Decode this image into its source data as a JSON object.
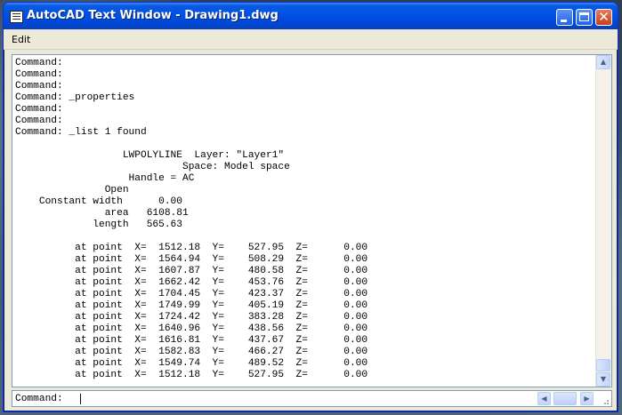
{
  "window": {
    "title": "AutoCAD Text Window - Drawing1.dwg",
    "icons": {
      "app": "text-window-icon",
      "minimize": "minimize-icon",
      "maximize": "maximize-icon",
      "close": "close-icon"
    }
  },
  "menu": {
    "items": [
      "Edit"
    ]
  },
  "log": {
    "lines": [
      "Command:",
      "Command:",
      "Command:",
      "Command: _properties",
      "Command:",
      "Command:",
      "Command: _list 1 found",
      "",
      "                  LWPOLYLINE  Layer: \"Layer1\"",
      "                            Space: Model space",
      "                   Handle = AC",
      "               Open",
      "    Constant width      0.00",
      "               area   6108.81",
      "             length   565.63",
      "",
      "          at point  X=  1512.18  Y=    527.95  Z=      0.00",
      "          at point  X=  1564.94  Y=    508.29  Z=      0.00",
      "          at point  X=  1607.87  Y=    480.58  Z=      0.00",
      "          at point  X=  1662.42  Y=    453.76  Z=      0.00",
      "          at point  X=  1704.45  Y=    423.37  Z=      0.00",
      "          at point  X=  1749.99  Y=    405.19  Z=      0.00",
      "          at point  X=  1724.42  Y=    383.28  Z=      0.00",
      "          at point  X=  1640.96  Y=    438.56  Z=      0.00",
      "          at point  X=  1616.81  Y=    437.67  Z=      0.00",
      "          at point  X=  1582.83  Y=    466.27  Z=      0.00",
      "          at point  X=  1549.74  Y=    489.52  Z=      0.00",
      "          at point  X=  1512.18  Y=    527.95  Z=      0.00"
    ]
  },
  "command_line": {
    "prompt": "Command:",
    "value": ""
  },
  "scrollbar": {
    "up_icon": "scroll-up-arrow-icon",
    "down_icon": "scroll-down-arrow-icon",
    "left_icon": "scroll-left-arrow-icon",
    "right_icon": "scroll-right-arrow-icon"
  }
}
